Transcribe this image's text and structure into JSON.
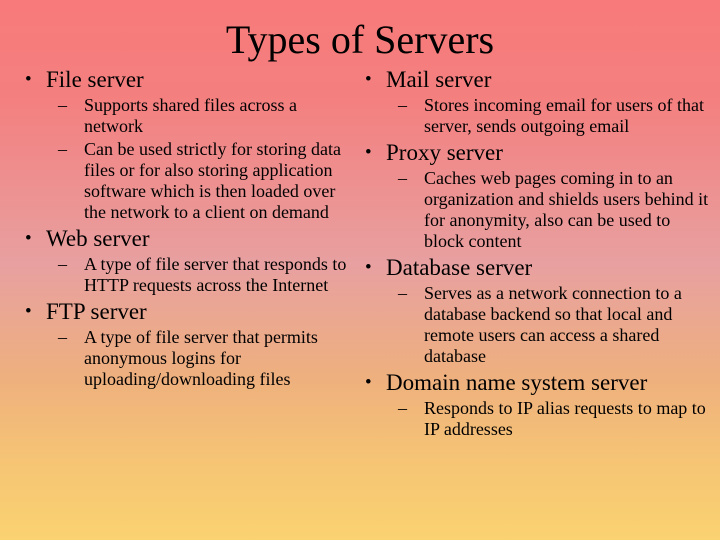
{
  "slide": {
    "title": "Types of Servers",
    "background": {
      "top_color": "#F87A7A",
      "mid_color": "#E8A0A0",
      "bottom_color": "#FAD271"
    },
    "text_color": "#000000",
    "bullet_level1_marker": "•",
    "bullet_level2_marker": "–",
    "columns": [
      {
        "id": "left",
        "items": [
          {
            "level": 1,
            "text": "File server"
          },
          {
            "level": 2,
            "text": "Supports shared files across a network"
          },
          {
            "level": 2,
            "text": "Can be used strictly for storing data files or for also storing application software which is then loaded over the network to a client on demand"
          },
          {
            "level": 1,
            "text": "Web server"
          },
          {
            "level": 2,
            "text": "A type of file server that responds to HTTP requests across the Internet"
          },
          {
            "level": 1,
            "text": "FTP server"
          },
          {
            "level": 2,
            "text": "A type of file server that permits anonymous logins for uploading/downloading files"
          }
        ]
      },
      {
        "id": "right",
        "items": [
          {
            "level": 1,
            "text": "Mail server"
          },
          {
            "level": 2,
            "text": "Stores incoming email for users of that server, sends outgoing email"
          },
          {
            "level": 1,
            "text": "Proxy server"
          },
          {
            "level": 2,
            "text": "Caches web pages coming in to an organization and shields users behind it for anonymity, also can be used to block content"
          },
          {
            "level": 1,
            "text": "Database server"
          },
          {
            "level": 2,
            "text": "Serves as a network connection to a database backend so that local and remote users can access a shared database"
          },
          {
            "level": 1,
            "text": "Domain name system server"
          },
          {
            "level": 2,
            "text": "Responds to IP alias requests to map to IP addresses"
          }
        ]
      }
    ]
  }
}
